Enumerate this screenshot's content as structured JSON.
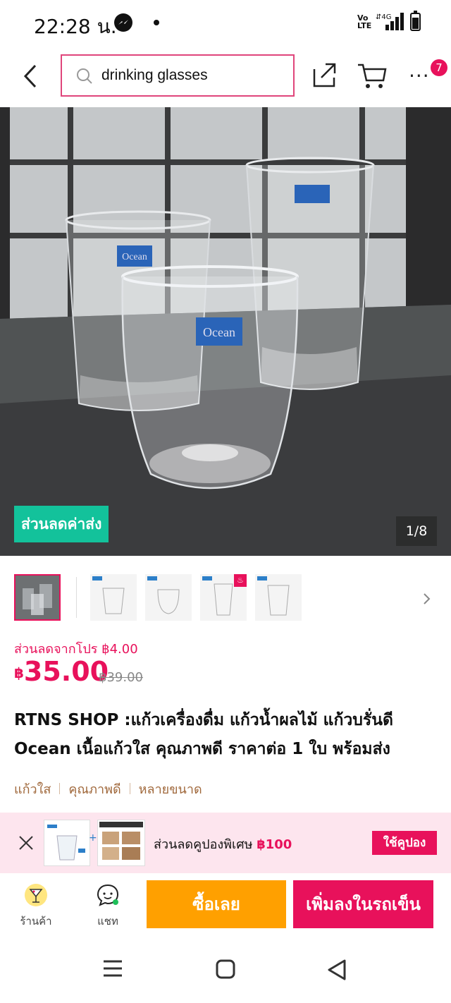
{
  "status_bar": {
    "time": "22:28 น.",
    "volte": "Vo\nLTE",
    "network": "4G"
  },
  "search": {
    "query": "drinking glasses"
  },
  "cart_badge": "7",
  "hero": {
    "promo_tag": "ส่วนลดค่าส่ง",
    "counter": "1/8",
    "glass_brand": "Ocean"
  },
  "price": {
    "promo_line": "ส่วนลดจากโปร ฿4.00",
    "currency": "฿",
    "amount": "35.00",
    "original": "฿39.00"
  },
  "title": "RTNS SHOP :แก้วเครื่องดื่ม แก้วน้ำผลไม้ แก้วบรั่นดี Ocean เนื้อแก้วใส คุณภาพดี ราคาต่อ 1 ใบ พร้อมส่ง",
  "tags": [
    "แก้วใส",
    "คุณภาพดี",
    "หลายขนาด"
  ],
  "coupon": {
    "text": "ส่วนลดคูปองพิเศษ ",
    "amount": "฿100",
    "button": "ใช้คูปอง"
  },
  "actions": {
    "store": "ร้านค้า",
    "chat": "แชท",
    "buy_now": "ซื้อเลย",
    "add_to_cart": "เพิ่มลงในรถเข็น"
  },
  "colors": {
    "accent": "#e8115b",
    "buy": "#ffa000",
    "promo_tag": "#13c29b",
    "coupon_bg": "#fde5ee"
  }
}
